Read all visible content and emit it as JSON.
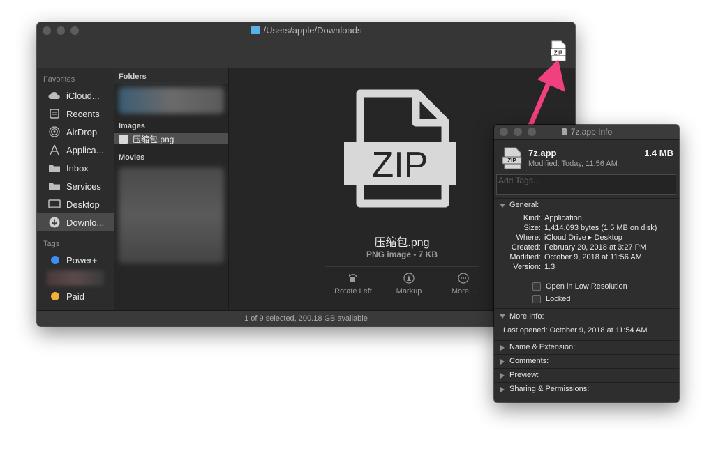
{
  "finder": {
    "title": "/Users/apple/Downloads",
    "sidebar": {
      "favorites_label": "Favorites",
      "favorites": [
        {
          "label": "iCloud...",
          "icon": "cloud-icon"
        },
        {
          "label": "Recents",
          "icon": "recents-icon"
        },
        {
          "label": "AirDrop",
          "icon": "airdrop-icon"
        },
        {
          "label": "Applica...",
          "icon": "applications-icon"
        },
        {
          "label": "Inbox",
          "icon": "folder-icon"
        },
        {
          "label": "Services",
          "icon": "folder-icon"
        },
        {
          "label": "Desktop",
          "icon": "desktop-icon"
        },
        {
          "label": "Downlo...",
          "icon": "downloads-icon"
        }
      ],
      "tags_label": "Tags",
      "tags": [
        {
          "label": "Power+",
          "color": "#3d8ff0"
        },
        {
          "label": "Paid",
          "color": "#f4b13a"
        }
      ]
    },
    "column": {
      "folders_label": "Folders",
      "images_label": "Images",
      "selected_file": "压缩包.png",
      "movies_label": "Movies"
    },
    "preview": {
      "zip_text": "ZIP",
      "filename": "压缩包.png",
      "filetype": "PNG image - 7 KB",
      "actions": {
        "rotate_left": "Rotate Left",
        "markup": "Markup",
        "more": "More..."
      }
    },
    "toolbar_zip_label": "ZIP",
    "status": "1 of 9 selected, 200.18 GB available"
  },
  "info": {
    "title": "7z.app Info",
    "app_name": "7z.app",
    "size": "1.4 MB",
    "modified_line": "Modified: Today, 11:56 AM",
    "tags_placeholder": "Add Tags...",
    "general_title": "General:",
    "general": [
      {
        "k": "Kind:",
        "v": "Application"
      },
      {
        "k": "Size:",
        "v": "1,414,093 bytes (1.5 MB on disk)"
      },
      {
        "k": "Where:",
        "v": "iCloud Drive ▸ Desktop"
      },
      {
        "k": "Created:",
        "v": "February 20, 2018 at 3:27 PM"
      },
      {
        "k": "Modified:",
        "v": "October 9, 2018 at 11:56 AM"
      },
      {
        "k": "Version:",
        "v": "1.3"
      }
    ],
    "checkbox_low_res": "Open in Low Resolution",
    "checkbox_locked": "Locked",
    "more_info_title": "More Info:",
    "last_opened": "Last opened: October 9, 2018 at 11:54 AM",
    "collapsed_sections": [
      "Name & Extension:",
      "Comments:",
      "Preview:",
      "Sharing & Permissions:"
    ]
  },
  "accent_arrow_color": "#f0407f"
}
